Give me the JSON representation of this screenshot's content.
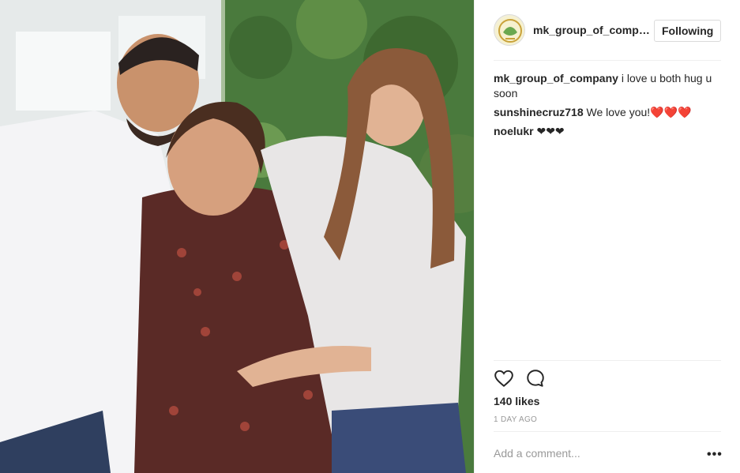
{
  "post": {
    "photo_alt": "Three people smiling",
    "account": {
      "username": "mk_group_of_company",
      "follow_label": "Following",
      "avatar_icon": "mk-logo-icon"
    },
    "comments": [
      {
        "user": "mk_group_of_company",
        "text": "i love u both hug u soon"
      },
      {
        "user": "sunshinecruz718",
        "text": "We love you!",
        "emoji": "❤️❤️❤️"
      },
      {
        "user": "noelukr",
        "text": "❤❤❤"
      }
    ],
    "likes": "140 likes",
    "time": "1 DAY AGO",
    "add_comment_placeholder": "Add a comment...",
    "more_label": "•••",
    "icons": {
      "like": "heart-icon",
      "comment": "comment-icon",
      "more": "more-options-icon"
    },
    "colors": {
      "accent_heart": "#e0245e",
      "muted": "#999999",
      "border": "#dbdbdb"
    }
  }
}
